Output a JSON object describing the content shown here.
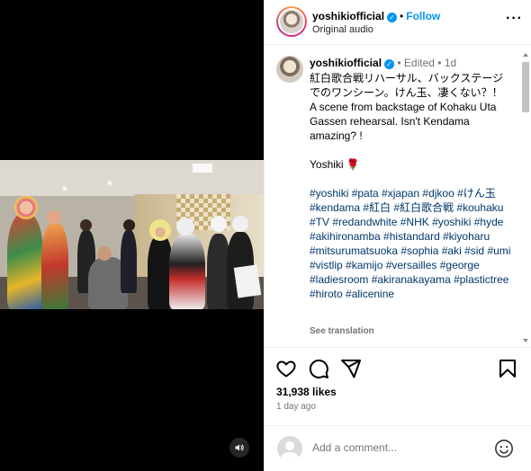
{
  "header": {
    "username": "yoshikiofficial",
    "follow_label": "Follow",
    "subtitle": "Original audio",
    "more_icon": "more-horizontal-icon"
  },
  "caption": {
    "username": "yoshikiofficial",
    "edited": "Edited",
    "age": "1d",
    "jp_text": "紅白歌合戦リハーサル、バックステージでのワンシーン。けん玉、凄くない？！",
    "en_text": "A scene from backstage of Kohaku Uta Gassen rehearsal. Isn't Kendama amazing? !",
    "signature": "Yoshiki 🌹",
    "hashtags": "#yoshiki #pata #xjapan #djkoo #けん玉 #kendama #紅白 #紅白歌合戦 #kouhaku #TV #redandwhite #NHK #yoshiki #hyde #akihironamba #histandard #kiyoharu #mitsurumatsuoka #sophia #aki #sid #umi #vistlip #kamijo #versailles #george #ladiesroom #akiranakayama #plastictree #hiroto #alicenine",
    "see_translation": "See translation"
  },
  "actions": {
    "icons": [
      "heart-icon",
      "comment-icon",
      "share-icon",
      "bookmark-icon"
    ]
  },
  "likes": "31,938 likes",
  "time": "1 day ago",
  "comment": {
    "placeholder": "Add a comment..."
  },
  "colors": {
    "link_blue": "#0095f6",
    "hashtag_blue": "#00376b",
    "muted": "#737373",
    "divider": "#efefef"
  }
}
